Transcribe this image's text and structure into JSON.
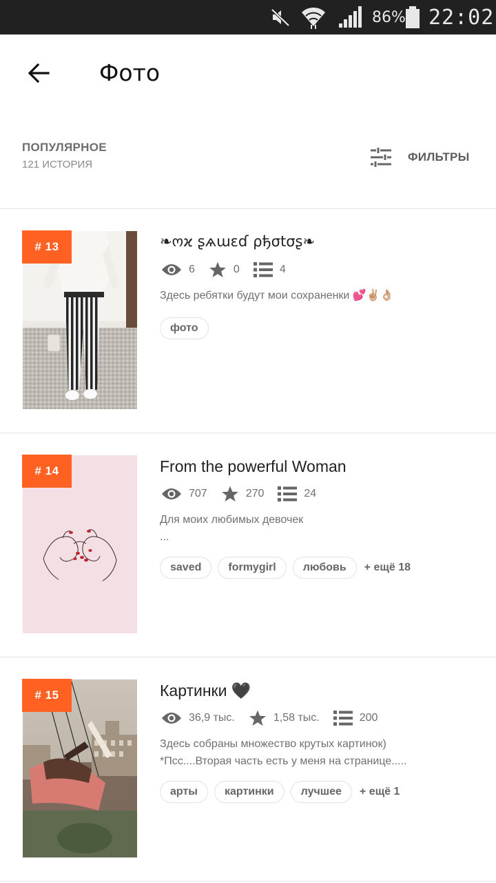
{
  "status_bar": {
    "battery_text": "86%",
    "time": "22:02",
    "icons": [
      "mute-icon",
      "wifi-icon",
      "signal-icon",
      "battery-icon"
    ]
  },
  "header": {
    "title": "Фото",
    "back_icon": "arrow-back-icon"
  },
  "sort": {
    "title": "ПОПУЛЯРНОЕ",
    "count": "121 ИСТОРИЯ"
  },
  "filters": {
    "label": "ФИЛЬТРЫ",
    "icon": "sliders-icon"
  },
  "stories": [
    {
      "rank": "# 13",
      "title": "❧ოϰ ʂѧɯɛɗ ρђσtσʂ❧",
      "views": "6",
      "votes": "0",
      "parts": "4",
      "description": "Здесь ребятки будут мои сохраненки 💕✌🏼👌🏼",
      "tags": [
        "фото"
      ],
      "more_tags": ""
    },
    {
      "rank": "# 14",
      "title": "From the powerful Woman",
      "views": "707",
      "votes": "270",
      "parts": "24",
      "description": "Для моих любимых девочек\n...",
      "tags": [
        "saved",
        "formygirl",
        "любовь"
      ],
      "more_tags": "+ ещё 18"
    },
    {
      "rank": "# 15",
      "title": "Картинки 🖤",
      "views": "36,9 тыс.",
      "votes": "1,58 тыс.",
      "parts": "200",
      "description": "Здесь собраны множество крутых картинок)\n*Псс....Вторая часть есть у меня на странице.....",
      "tags": [
        "арты",
        "картинки",
        "лучшее"
      ],
      "more_tags": "+ ещё 1"
    }
  ],
  "colors": {
    "accent": "#ff6122",
    "status_bar": "#212121",
    "text_secondary": "#707070"
  }
}
